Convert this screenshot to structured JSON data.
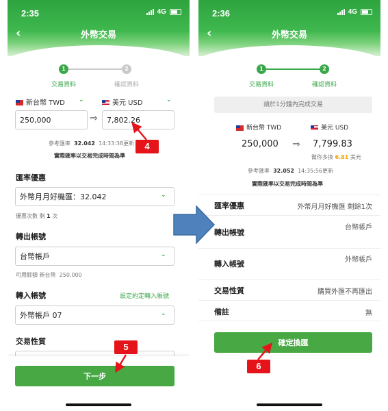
{
  "left": {
    "status_time": "2:35",
    "network": "4G",
    "title": "外幣交易",
    "steps": [
      {
        "number": "1",
        "label": "交易資料"
      },
      {
        "number": "2",
        "label": "確認資料"
      }
    ],
    "from_currency": "新台幣 TWD",
    "to_currency": "美元 USD",
    "from_amount": "250,000",
    "to_amount": "7,802.26",
    "rate_label": "參考匯率",
    "rate_value": "32.042",
    "rate_time": "14:33:38更新",
    "rate_note": "實際匯率以交易完成時間為準",
    "discount_label": "匯率優惠",
    "discount_value": "外幣月月好機匯：32.042",
    "discount_count_prefix": "優惠次數 剩",
    "discount_count": "1",
    "discount_count_suffix": "次",
    "out_account_label": "轉出帳號",
    "out_account_value": "台幣帳戶",
    "available_label": "可用餘額 新台幣",
    "available_value": "250,000",
    "in_account_label": "轉入帳號",
    "in_account_link": "設定約定轉入帳號",
    "in_account_value": "外幣帳戶 07",
    "trade_type_label": "交易性質",
    "next_button": "下一步"
  },
  "right": {
    "status_time": "2:36",
    "network": "4G",
    "title": "外幣交易",
    "steps": [
      {
        "number": "1",
        "label": "交易資料"
      },
      {
        "number": "2",
        "label": "確認資料"
      }
    ],
    "notice": "請於1分鐘內完成交易",
    "from_currency": "新台幣 TWD",
    "to_currency": "美元 USD",
    "from_amount": "250,000",
    "to_amount": "7,799.83",
    "saving_prefix": "幫你多換",
    "saving_value": "6.81",
    "saving_suffix": "美元",
    "rate_label": "參考匯率",
    "rate_value": "32.052",
    "rate_time": "14:35:56更新",
    "rate_note": "實際匯率以交易完成時間為準",
    "rows": [
      {
        "label": "匯率優惠",
        "value": "外幣月月好機匯 剩餘1次"
      },
      {
        "label": "轉出帳號",
        "value": "台幣帳戶"
      },
      {
        "label": "轉入帳號",
        "value": "外幣帳戶"
      },
      {
        "label": "交易性質",
        "value": "購買外匯不再匯出"
      },
      {
        "label": "備註",
        "value": "無"
      }
    ],
    "confirm_button": "確定換匯"
  },
  "annotations": {
    "badge_4": "4",
    "badge_5": "5",
    "badge_6": "6"
  },
  "colors": {
    "brand_green": "#47a844",
    "annotation_red": "#e5141b",
    "arrow_blue": "#4f81bd",
    "highlight_orange": "#f0a500"
  },
  "icons": [
    "back-arrow-icon",
    "chevron-down-icon",
    "exchange-arrow-icon",
    "flag-tw-icon",
    "flag-us-icon",
    "signal-icon",
    "battery-icon"
  ]
}
